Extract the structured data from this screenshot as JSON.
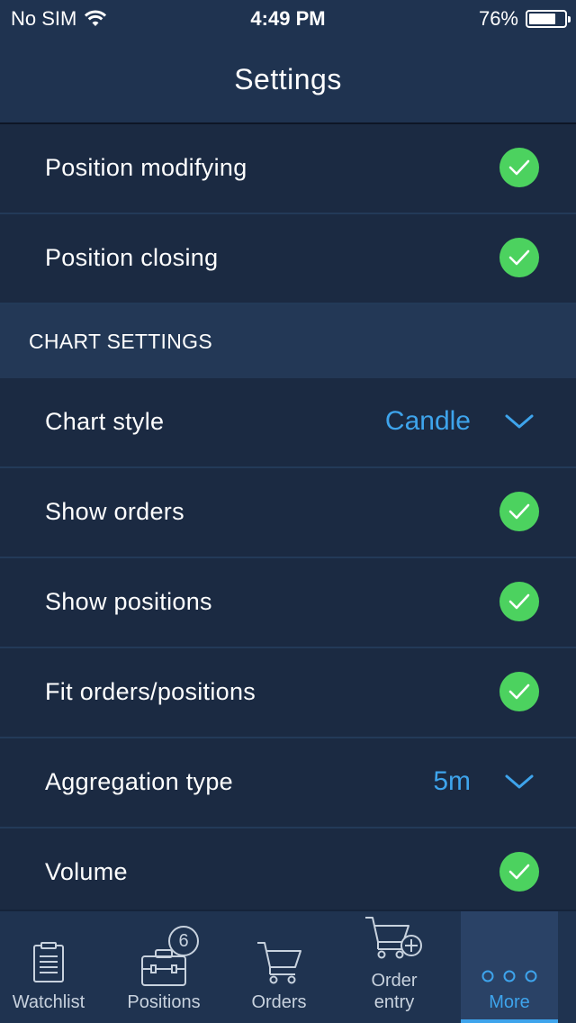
{
  "status_bar": {
    "carrier": "No SIM",
    "time": "4:49 PM",
    "battery_percent": "76%",
    "battery_level": 0.76,
    "wifi_icon": "wifi-icon"
  },
  "header": {
    "title": "Settings"
  },
  "rows_top": [
    {
      "label": "Position modifying",
      "checked": true
    },
    {
      "label": "Position closing",
      "checked": true
    }
  ],
  "chart_settings": {
    "section_title": "CHART SETTINGS",
    "chart_style": {
      "label": "Chart style",
      "value": "Candle"
    },
    "show_orders": {
      "label": "Show orders",
      "checked": true
    },
    "show_positions": {
      "label": "Show positions",
      "checked": true
    },
    "fit_orders_positions": {
      "label": "Fit orders/positions",
      "checked": true
    },
    "aggregation_type": {
      "label": "Aggregation type",
      "value": "5m"
    },
    "volume": {
      "label": "Volume",
      "checked": true
    }
  },
  "tabs": [
    {
      "label": "Watchlist",
      "icon": "clipboard-icon"
    },
    {
      "label": "Positions",
      "icon": "briefcase-icon",
      "badge": "6"
    },
    {
      "label": "Orders",
      "icon": "cart-icon"
    },
    {
      "label_line1": "Order",
      "label_line2": "entry",
      "icon": "cart-add-icon"
    },
    {
      "label": "More",
      "icon": "more-dots-icon",
      "active": true
    }
  ],
  "colors": {
    "accent": "#3ea4ec",
    "check_green": "#4cd25f",
    "background": "#1b2a42",
    "bar": "#1f3350"
  }
}
